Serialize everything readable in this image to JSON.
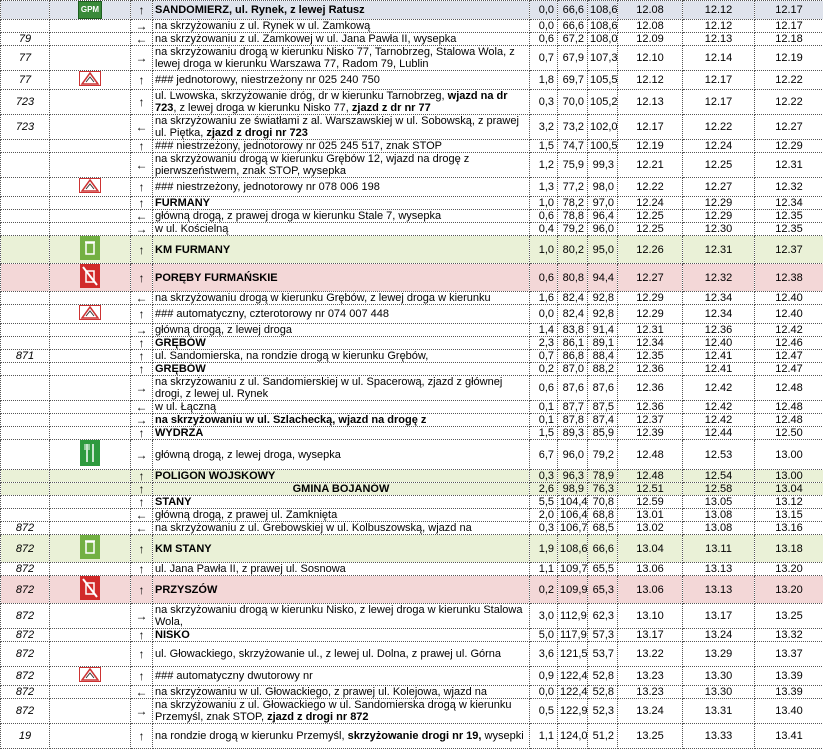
{
  "colors": {
    "gray_row": "#dfe3ec",
    "green_row": "#eaf1d7",
    "pink_row": "#f3d7d7",
    "icon_red": "#d12a2a",
    "icon_green": "#2e9a3e"
  },
  "rows": [
    {
      "road": "",
      "icons": [
        "gpm"
      ],
      "arrow": "↑",
      "text": "SANDOMIERZ, ul. Rynek, z lewej Ratusz",
      "km1": "0,0",
      "km2": "66,6",
      "km3": "108,6",
      "t1": "12.08",
      "t2": "12.12",
      "t3": "12.17",
      "bold": true,
      "hl": "gray",
      "tall": false,
      "gpm_label": "GPM"
    },
    {
      "road": "",
      "icons": [],
      "arrow": "→",
      "text": "na skrzyżowaniu z ul. Rynek w ul. Zamkową",
      "km1": "0,0",
      "km2": "66,6",
      "km3": "108,6",
      "t1": "12.08",
      "t2": "12.12",
      "t3": "12.17",
      "tall": false
    },
    {
      "road": "79",
      "icons": [],
      "arrow": "←",
      "text": "na skrzyżowaniu z ul. Zamkowej w ul. Jana Pawła II, wysepka",
      "km1": "0,6",
      "km2": "67,2",
      "km3": "108,0",
      "t1": "12.09",
      "t2": "12.13",
      "t3": "12.18",
      "tall": false
    },
    {
      "road": "77",
      "icons": [],
      "arrow": "→",
      "text": "na skrzyżowaniu drogą w kierunku Nisko 77, Tarnobrzeg, Stalowa Wola, z lewej droga w kierunku Warszawa 77, Radom 79, Lublin",
      "km1": "0,7",
      "km2": "67,9",
      "km3": "107,3",
      "t1": "12.10",
      "t2": "12.14",
      "t3": "12.19",
      "tall": true
    },
    {
      "road": "77",
      "icons": [
        "warn"
      ],
      "arrow": "↑",
      "text": "### jednotorowy, niestrzeżony nr 025 240 750",
      "km1": "1,8",
      "km2": "69,7",
      "km3": "105,5",
      "t1": "12.12",
      "t2": "12.17",
      "t3": "12.22",
      "tall": false
    },
    {
      "road": "723",
      "icons": [],
      "arrow": "↑",
      "text": "ul. Lwowska, skrzyżowanie dróg, dr w kierunku Tarnobrzeg, ",
      "textb": "wjazd na dr 723",
      "text2": ", z lewej droga w kierunku Nisko 77, ",
      "textb2": "zjazd z dr nr 77",
      "km1": "0,3",
      "km2": "70,0",
      "km3": "105,2",
      "t1": "12.13",
      "t2": "12.17",
      "t3": "12.22",
      "tall": true
    },
    {
      "road": "723",
      "icons": [],
      "arrow": "←",
      "text": "na skrzyżowaniu ze światłami z al. Warszawskiej w ul. Sobowską, z prawej ul. Piętka, ",
      "textb": "zjazd z drogi nr 723",
      "km1": "3,2",
      "km2": "73,2",
      "km3": "102,0",
      "t1": "12.17",
      "t2": "12.22",
      "t3": "12.27",
      "tall": true
    },
    {
      "road": "",
      "icons": [],
      "arrow": "↑",
      "text": "### niestrzeżony, jednotorowy nr 025 245 517, znak STOP",
      "km1": "1,5",
      "km2": "74,7",
      "km3": "100,5",
      "t1": "12.19",
      "t2": "12.24",
      "t3": "12.29",
      "tall": false
    },
    {
      "road": "",
      "icons": [],
      "arrow": "←",
      "text": "na skrzyżowaniu drogą w kierunku Grębów 12, wjazd na drogę z pierwszeństwem, znak STOP, wysepka",
      "km1": "1,2",
      "km2": "75,9",
      "km3": "99,3",
      "t1": "12.21",
      "t2": "12.25",
      "t3": "12.31",
      "tall": true
    },
    {
      "road": "",
      "icons": [
        "warn"
      ],
      "arrow": "↑",
      "text": "### niestrzeżony, jednotorowy nr 078 006 198",
      "km1": "1,3",
      "km2": "77,2",
      "km3": "98,0",
      "t1": "12.22",
      "t2": "12.27",
      "t3": "12.32",
      "tall": false
    },
    {
      "road": "",
      "icons": [],
      "arrow": "↑",
      "text": "FURMANY",
      "km1": "1,0",
      "km2": "78,2",
      "km3": "97,0",
      "t1": "12.24",
      "t2": "12.29",
      "t3": "12.34",
      "bold": true,
      "tall": false
    },
    {
      "road": "",
      "icons": [],
      "arrow": "←",
      "text": "główną drogą, z prawej droga w kierunku Stale 7, wysepka",
      "km1": "0,6",
      "km2": "78,8",
      "km3": "96,4",
      "t1": "12.25",
      "t2": "12.29",
      "t3": "12.35",
      "tall": false
    },
    {
      "road": "",
      "icons": [],
      "arrow": "→",
      "text": "w ul. Kościelną",
      "km1": "0,4",
      "km2": "79,2",
      "km3": "96,0",
      "t1": "12.25",
      "t2": "12.30",
      "t3": "12.35",
      "tall": false
    },
    {
      "road": "",
      "icons": [
        "bin"
      ],
      "arrow": "↑",
      "text": "KM FURMANY",
      "km1": "1,0",
      "km2": "80,2",
      "km3": "95,0",
      "t1": "12.26",
      "t2": "12.31",
      "t3": "12.37",
      "bold": true,
      "hl": "green",
      "tall": false
    },
    {
      "road": "",
      "icons": [
        "nobin"
      ],
      "arrow": "↑",
      "text": "PORĘBY FURMAŃSKIE",
      "km1": "0,6",
      "km2": "80,8",
      "km3": "94,4",
      "t1": "12.27",
      "t2": "12.32",
      "t3": "12.38",
      "bold": true,
      "hl": "pink",
      "tall": false
    },
    {
      "road": "",
      "icons": [],
      "arrow": "←",
      "text": "na skrzyżowaniu drogą w kierunku Grębów, z lewej droga w kierunku",
      "km1": "1,6",
      "km2": "82,4",
      "km3": "92,8",
      "t1": "12.29",
      "t2": "12.34",
      "t3": "12.40",
      "tall": false
    },
    {
      "road": "",
      "icons": [
        "warn"
      ],
      "arrow": "↑",
      "text": "### automatyczny, czterotorowy nr 074 007 448",
      "km1": "0,0",
      "km2": "82,4",
      "km3": "92,8",
      "t1": "12.29",
      "t2": "12.34",
      "t3": "12.40",
      "tall": false
    },
    {
      "road": "",
      "icons": [],
      "arrow": "→",
      "text": "główną drogą, z lewej droga",
      "km1": "1,4",
      "km2": "83,8",
      "km3": "91,4",
      "t1": "12.31",
      "t2": "12.36",
      "t3": "12.42",
      "tall": false
    },
    {
      "road": "",
      "icons": [],
      "arrow": "↑",
      "text": "GRĘBÓW",
      "km1": "2,3",
      "km2": "86,1",
      "km3": "89,1",
      "t1": "12.34",
      "t2": "12.40",
      "t3": "12.46",
      "bold": true,
      "tall": false
    },
    {
      "road": "871",
      "icons": [],
      "arrow": "↑",
      "text": "ul. Sandomierska, na rondzie drogą w kierunku Grębów,",
      "km1": "0,7",
      "km2": "86,8",
      "km3": "88,4",
      "t1": "12.35",
      "t2": "12.41",
      "t3": "12.47",
      "tall": false
    },
    {
      "road": "",
      "icons": [],
      "arrow": "↑",
      "text": "GRĘBÓW",
      "km1": "0,2",
      "km2": "87,0",
      "km3": "88,2",
      "t1": "12.36",
      "t2": "12.41",
      "t3": "12.47",
      "bold": true,
      "tall": false
    },
    {
      "road": "",
      "icons": [],
      "arrow": "→",
      "text": "na skrzyżowaniu z ul. Sandomierskiej w ul. Spacerową, zjazd z głównej drogi, z lewej ul. Rynek",
      "km1": "0,6",
      "km2": "87,6",
      "km3": "87,6",
      "t1": "12.36",
      "t2": "12.42",
      "t3": "12.48",
      "tall": true
    },
    {
      "road": "",
      "icons": [],
      "arrow": "←",
      "text": "w ul. Łączną",
      "km1": "0,1",
      "km2": "87,7",
      "km3": "87,5",
      "t1": "12.36",
      "t2": "12.42",
      "t3": "12.48",
      "tall": false
    },
    {
      "road": "",
      "icons": [],
      "arrow": "→",
      "text": "na skrzyżowaniu w ul. Szlachecką, wjazd na drogę z",
      "km1": "0,1",
      "km2": "87,8",
      "km3": "87,4",
      "t1": "12.37",
      "t2": "12.42",
      "t3": "12.48",
      "bold": true,
      "tall": false
    },
    {
      "road": "",
      "icons": [],
      "arrow": "↑",
      "text": "WYDRZA",
      "km1": "1,5",
      "km2": "89,3",
      "km3": "85,9",
      "t1": "12.39",
      "t2": "12.44",
      "t3": "12.50",
      "bold": true,
      "tall": false
    },
    {
      "road": "",
      "icons": [
        "fork"
      ],
      "arrow": "→",
      "text": "główną drogą, z lewej droga, wysepka",
      "km1": "6,7",
      "km2": "96,0",
      "km3": "79,2",
      "t1": "12.48",
      "t2": "12.53",
      "t3": "13.00",
      "tall": false
    },
    {
      "road": "",
      "icons": [],
      "arrow": "↑",
      "text": "POLIGON WOJSKOWY",
      "km1": "0,3",
      "km2": "96,3",
      "km3": "78,9",
      "t1": "12.48",
      "t2": "12.54",
      "t3": "13.00",
      "bold": true,
      "hl": "green",
      "tall": false
    },
    {
      "road": "",
      "icons": [],
      "arrow": "↑",
      "text": "GMINA BOJANÓW",
      "km1": "2,6",
      "km2": "98,9",
      "km3": "76,3",
      "t1": "12.51",
      "t2": "12.58",
      "t3": "13.04",
      "bold": true,
      "center": true,
      "hl": "green",
      "tall": false
    },
    {
      "road": "",
      "icons": [],
      "arrow": "↑",
      "text": "STANY",
      "km1": "5,5",
      "km2": "104,4",
      "km3": "70,8",
      "t1": "12.59",
      "t2": "13.05",
      "t3": "13.12",
      "bold": true,
      "tall": false
    },
    {
      "road": "",
      "icons": [],
      "arrow": "←",
      "text": "główną drogą, z prawej ul. Zamknięta",
      "km1": "2,0",
      "km2": "106,4",
      "km3": "68,8",
      "t1": "13.01",
      "t2": "13.08",
      "t3": "13.15",
      "tall": false
    },
    {
      "road": "872",
      "icons": [],
      "arrow": "←",
      "text": "na skrzyżowaniu z ul. Grebowskiej w ul. Kolbuszowską, wjazd na",
      "km1": "0,3",
      "km2": "106,7",
      "km3": "68,5",
      "t1": "13.02",
      "t2": "13.08",
      "t3": "13.16",
      "tall": false
    },
    {
      "road": "872",
      "icons": [
        "bin"
      ],
      "arrow": "↑",
      "text": "KM STANY",
      "km1": "1,9",
      "km2": "108,6",
      "km3": "66,6",
      "t1": "13.04",
      "t2": "13.11",
      "t3": "13.18",
      "bold": true,
      "hl": "green",
      "tall": false
    },
    {
      "road": "872",
      "icons": [],
      "arrow": "↑",
      "text": "ul. Jana Pawła II, z prawej ul. Sosnowa",
      "km1": "1,1",
      "km2": "109,7",
      "km3": "65,5",
      "t1": "13.06",
      "t2": "13.13",
      "t3": "13.20",
      "tall": false
    },
    {
      "road": "872",
      "icons": [
        "nobin"
      ],
      "arrow": "↑",
      "text": "PRZYSZÓW",
      "km1": "0,2",
      "km2": "109,9",
      "km3": "65,3",
      "t1": "13.06",
      "t2": "13.13",
      "t3": "13.20",
      "bold": true,
      "hl": "pink",
      "tall": false
    },
    {
      "road": "872",
      "icons": [],
      "arrow": "→",
      "text": "na skrzyżowaniu drogą w kierunku Nisko, z lewej droga w kierunku Stalowa Wola,",
      "km1": "3,0",
      "km2": "112,9",
      "km3": "62,3",
      "t1": "13.10",
      "t2": "13.17",
      "t3": "13.25",
      "tall": true
    },
    {
      "road": "872",
      "icons": [],
      "arrow": "↑",
      "text": "NISKO",
      "km1": "5,0",
      "km2": "117,9",
      "km3": "57,3",
      "t1": "13.17",
      "t2": "13.24",
      "t3": "13.32",
      "bold": true,
      "tall": false
    },
    {
      "road": "872",
      "icons": [],
      "arrow": "↑",
      "text": "ul. Głowackiego, skrzyżowanie ul., z lewej ul. Dolna, z prawej ul. Górna",
      "km1": "3,6",
      "km2": "121,5",
      "km3": "53,7",
      "t1": "13.22",
      "t2": "13.29",
      "t3": "13.37",
      "tall": true
    },
    {
      "road": "872",
      "icons": [
        "warn"
      ],
      "arrow": "↑",
      "text": "### automatyczny dwutorowy nr",
      "km1": "0,9",
      "km2": "122,4",
      "km3": "52,8",
      "t1": "13.23",
      "t2": "13.30",
      "t3": "13.39",
      "tall": false
    },
    {
      "road": "872",
      "icons": [],
      "arrow": "←",
      "text": "na skrzyżowaniu w ul. Głowackiego, z prawej ul. Kolejowa, wjazd na",
      "km1": "0,0",
      "km2": "122,4",
      "km3": "52,8",
      "t1": "13.23",
      "t2": "13.30",
      "t3": "13.39",
      "tall": false
    },
    {
      "road": "872",
      "icons": [],
      "arrow": "→",
      "text": "na skrzyżowaniu z ul. Głowackiego w ul. Sandomierska drogą w kierunku Przemyśl, znak STOP, ",
      "textb": "zjazd z drogi nr 872",
      "km1": "0,5",
      "km2": "122,9",
      "km3": "52,3",
      "t1": "13.24",
      "t2": "13.31",
      "t3": "13.40",
      "tall": true
    },
    {
      "road": "19",
      "icons": [],
      "arrow": "↑",
      "text": "na rondzie drogą w kierunku Przemyśl, ",
      "textb": "skrzyżowanie drogi nr 19,",
      "text2": " wysepki",
      "km1": "1,1",
      "km2": "124,0",
      "km3": "51,2",
      "t1": "13.25",
      "t2": "13.33",
      "t3": "13.41",
      "tall": true
    }
  ]
}
